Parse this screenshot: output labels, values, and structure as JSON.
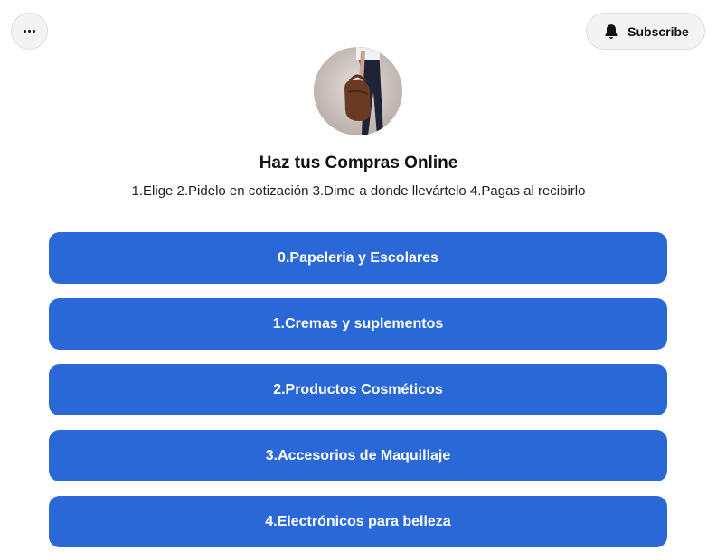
{
  "header": {
    "more_icon": "more-horizontal-icon",
    "subscribe_label": "Subscribe",
    "subscribe_icon": "bell-icon"
  },
  "profile": {
    "title": "Haz tus Compras Online",
    "description": "1.Elige 2.Pidelo en cotización 3.Dime a donde llevártelo 4.Pagas al recibirlo"
  },
  "links": [
    {
      "label": "0.Papeleria y  Escolares"
    },
    {
      "label": "1.Cremas y suplementos"
    },
    {
      "label": "2.Productos Cosméticos"
    },
    {
      "label": "3.Accesorios de Maquillaje"
    },
    {
      "label": "4.Electrónicos para belleza"
    }
  ],
  "colors": {
    "button_bg": "#2a68d8",
    "button_text": "#ffffff",
    "page_bg": "#ffffff"
  }
}
